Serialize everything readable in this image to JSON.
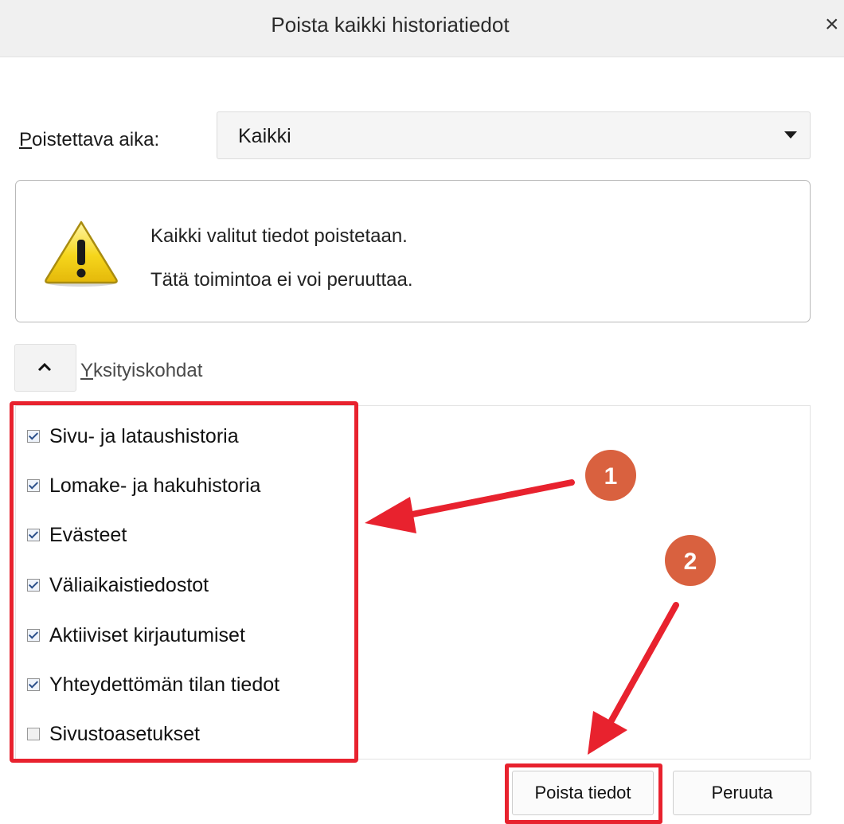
{
  "dialog": {
    "title": "Poista kaikki historiatiedot",
    "close_symbol": "×"
  },
  "time_range": {
    "label_accesskey": "P",
    "label_rest": "oistettava aika:",
    "selected": "Kaikki"
  },
  "warning": {
    "icon": "warning-triangle-icon",
    "line1": "Kaikki valitut tiedot poistetaan.",
    "line2": "Tätä toimintoa ei voi peruuttaa."
  },
  "details": {
    "toggle_icon": "chevron-up-icon",
    "label_accesskey": "Y",
    "label_rest": "ksityiskohdat",
    "items": [
      {
        "label": "Sivu- ja lataushistoria",
        "checked": true
      },
      {
        "label": "Lomake- ja hakuhistoria",
        "checked": true
      },
      {
        "label": "Evästeet",
        "checked": true
      },
      {
        "label": "Väliaikaistiedostot",
        "checked": true
      },
      {
        "label": "Aktiiviset kirjautumiset",
        "checked": true
      },
      {
        "label": "Yhteydettömän tilan tiedot",
        "checked": true
      },
      {
        "label": "Sivustoasetukset",
        "checked": false
      }
    ]
  },
  "buttons": {
    "delete": "Poista tiedot",
    "cancel": "Peruuta"
  },
  "annotations": {
    "marker1": "1",
    "marker2": "2",
    "highlight_color": "#e8222e",
    "marker_color": "#d9613f"
  }
}
